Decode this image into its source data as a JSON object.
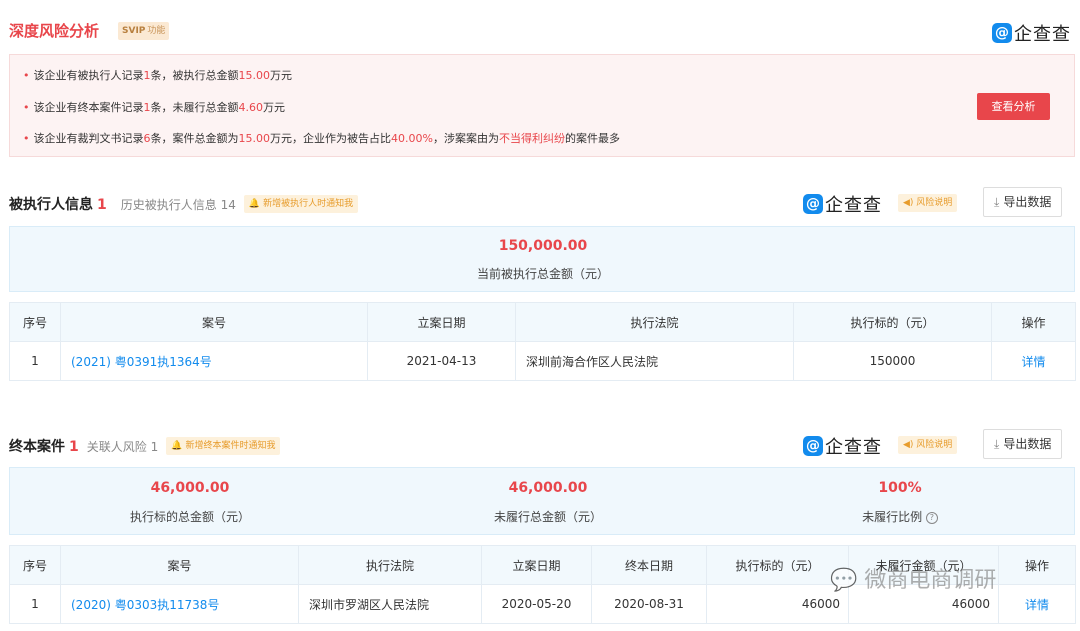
{
  "header": {
    "title": "深度风险分析",
    "svip_badge": "SVIP",
    "svip_text": "功能",
    "logo_text": "企查查"
  },
  "risk": {
    "line1": {
      "a": "该企业有被执行人记录",
      "n1": "1",
      "b": "条，被执行总金额",
      "n2": "15.00",
      "c": "万元"
    },
    "line2": {
      "a": "该企业有终本案件记录",
      "n1": "1",
      "b": "条，未履行总金额",
      "n2": "4.60",
      "c": "万元"
    },
    "line3": {
      "a": "该企业有裁判文书记录",
      "n1": "6",
      "b": "条，案件总金额为",
      "n2": "15.00",
      "c": "万元，企业作为被告占比",
      "n3": "40.00%",
      "d": "，涉案案由为",
      "n4": "不当得利纠纷",
      "e": "的案件最多"
    },
    "analyze_button": "查看分析"
  },
  "executed": {
    "title": "被执行人信息",
    "count": "1",
    "history_label": "历史被执行人信息",
    "history_count": "14",
    "notify_label": "新增被执行人时通知我",
    "logo_text": "企查查",
    "risk_note": "风险说明",
    "export_label": "导出数据",
    "total_value": "150,000.00",
    "total_label": "当前被执行总金额（元）",
    "columns": [
      "序号",
      "案号",
      "立案日期",
      "执行法院",
      "执行标的（元）",
      "操作"
    ],
    "rows": [
      {
        "no": "1",
        "case_no": "(2021) 粤0391执1364号",
        "date": "2021-04-13",
        "court": "深圳前海合作区人民法院",
        "amount": "150000",
        "action": "详情"
      }
    ]
  },
  "terminated": {
    "title": "终本案件",
    "count": "1",
    "related_label": "关联人风险",
    "related_count": "1",
    "notify_label": "新增终本案件时通知我",
    "logo_text": "企查查",
    "risk_note": "风险说明",
    "export_label": "导出数据",
    "stat1_value": "46,000.00",
    "stat1_label": "执行标的总金额（元）",
    "stat2_value": "46,000.00",
    "stat2_label": "未履行总金额（元）",
    "stat3_value": "100%",
    "stat3_label": "未履行比例",
    "columns": [
      "序号",
      "案号",
      "执行法院",
      "立案日期",
      "终本日期",
      "执行标的（元）",
      "未履行金额（元）",
      "操作"
    ],
    "rows": [
      {
        "no": "1",
        "case_no": "(2020) 粤0303执11738号",
        "court": "深圳市罗湖区人民法院",
        "date": "2020-05-20",
        "end_date": "2020-08-31",
        "amount": "46000",
        "unpaid": "46000",
        "action": "详情"
      }
    ]
  },
  "watermark": "微商电商调研"
}
